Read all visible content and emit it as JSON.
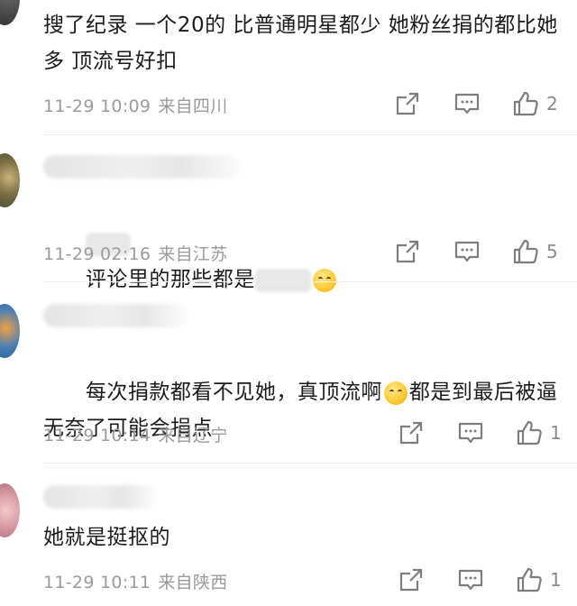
{
  "comments": [
    {
      "text": "搜了纪录 一个20的 比普通明星都少 她粉丝捐的都比她多 顶流号好扣",
      "time": "11-29 10:09",
      "location": "来自四川",
      "likes": "2"
    },
    {
      "text_after": "评论里的那些都是",
      "time": "11-29 02:16",
      "location": "来自江苏",
      "likes": "5"
    },
    {
      "text_part1": "每次捐款都看不见她，真顶流啊",
      "text_part2": "都是到最后被逼无奈了可能会捐点",
      "time": "11-29 10:14",
      "location": "来自辽宁",
      "likes": "1"
    },
    {
      "text": "她就是挺抠的",
      "time": "11-29 10:11",
      "location": "来自陕西",
      "likes": "1"
    }
  ],
  "icons": {
    "share": "share-icon",
    "comment": "comment-icon",
    "like": "thumbs-up-icon"
  },
  "colors": {
    "meta": "#9a9a9a",
    "icon": "#7d7d7d",
    "divider": "#ececec"
  }
}
